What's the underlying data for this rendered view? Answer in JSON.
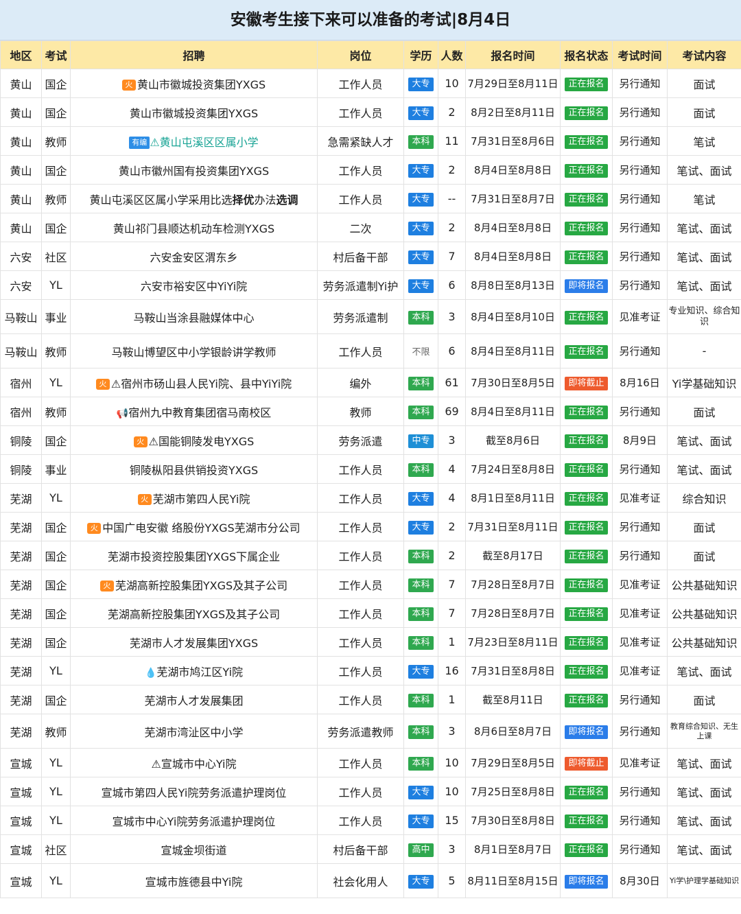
{
  "title": "安徽考生接下来可以准备的考试|8月4日",
  "headers": [
    "地区",
    "考试",
    "招聘",
    "岗位",
    "学历",
    "人数",
    "报名时间",
    "报名状态",
    "考试时间",
    "考试内容"
  ],
  "rows": [
    {
      "region": "黄山",
      "type": "国企",
      "prefix": "火",
      "recruit": "黄山市徽城投资集团YXGS",
      "post": "工作人员",
      "edu": "大专",
      "count": "10",
      "time": "7月29日至8月11日",
      "status": "正在报名",
      "exam_time": "另行通知",
      "content": "面试"
    },
    {
      "region": "黄山",
      "type": "国企",
      "recruit": "黄山市徽城投资集团YXGS",
      "post": "工作人员",
      "edu": "大专",
      "count": "2",
      "time": "8月2日至8月11日",
      "status": "正在报名",
      "exam_time": "另行通知",
      "content": "面试"
    },
    {
      "region": "黄山",
      "type": "教师",
      "tag": "有编",
      "recruit": "⚠黄山屯溪区区属小学",
      "post": "急需紧缺人才",
      "edu": "本科",
      "count": "11",
      "time": "7月31日至8月6日",
      "status": "正在报名",
      "exam_time": "另行通知",
      "content": "笔试"
    },
    {
      "region": "黄山",
      "type": "国企",
      "recruit": "黄山市徽州国有投资集团YXGS",
      "post": "工作人员",
      "edu": "大专",
      "count": "2",
      "time": "8月4日至8月8日",
      "status": "正在报名",
      "exam_time": "另行通知",
      "content": "笔试、面试"
    },
    {
      "region": "黄山",
      "type": "教师",
      "recruit": "黄山屯溪区区属小学采用比选",
      "recruit_bold": "择优",
      "recruit_tail": "办法",
      "recruit_bold2": "选调",
      "post": "工作人员",
      "edu": "大专",
      "count": "--",
      "time": "7月31日至8月7日",
      "status": "正在报名",
      "exam_time": "另行通知",
      "content": "笔试"
    },
    {
      "region": "黄山",
      "type": "国企",
      "recruit": "黄山祁门县顺达机动车检测YXGS",
      "post": "二次",
      "edu": "大专",
      "count": "2",
      "time": "8月4日至8月8日",
      "status": "正在报名",
      "exam_time": "另行通知",
      "content": "笔试、面试"
    },
    {
      "region": "六安",
      "type": "社区",
      "recruit": "六安金安区渭东乡",
      "post": "村后备干部",
      "edu": "大专",
      "count": "7",
      "time": "8月4日至8月8日",
      "status": "正在报名",
      "exam_time": "另行通知",
      "content": "笔试、面试"
    },
    {
      "region": "六安",
      "type": "YL",
      "recruit": "六安市裕安区中YiYi院",
      "post": "劳务派遣制Yi护",
      "post_bold": "派遣制",
      "edu": "大专",
      "count": "6",
      "time": "8月8日至8月13日",
      "status": "即将报名",
      "exam_time": "另行通知",
      "content": "笔试、面试"
    },
    {
      "region": "马鞍山",
      "type": "事业",
      "recruit": "马鞍山当涂县融媒体中心",
      "post": "劳务派遣制",
      "post_bold": "派遣制",
      "edu": "本科",
      "count": "3",
      "time": "8月4日至8月10日",
      "status": "正在报名",
      "exam_time": "见准考证",
      "content": "专业知识、综合知识"
    },
    {
      "region": "马鞍山",
      "type": "教师",
      "recruit": "马鞍山博望区中小学银龄讲学教师",
      "post": "工作人员",
      "edu": "不限",
      "count": "6",
      "time": "8月4日至8月11日",
      "status": "正在报名",
      "exam_time": "另行通知",
      "content": "-"
    },
    {
      "region": "宿州",
      "type": "YL",
      "prefix": "火",
      "recruit": "⚠宿州市砀山县人民Yi院、县中YiYi院",
      "post": "编外",
      "edu": "本科",
      "count": "61",
      "time": "7月30日至8月5日",
      "status": "即将截止",
      "exam_time": "8月16日",
      "content": "Yi学基础知识"
    },
    {
      "region": "宿州",
      "type": "教师",
      "prefix": "📢",
      "recruit": "宿州九中教育集团宿马南校区",
      "post": "教师",
      "edu": "本科",
      "count": "69",
      "time": "8月4日至8月11日",
      "status": "正在报名",
      "exam_time": "另行通知",
      "content": "面试"
    },
    {
      "region": "铜陵",
      "type": "国企",
      "prefix": "火",
      "recruit": "⚠国能铜陵发电YXGS",
      "post": "劳务派遣",
      "edu": "中专",
      "count": "3",
      "time": "截至8月6日",
      "status": "正在报名",
      "exam_time": "8月9日",
      "content": "笔试、面试"
    },
    {
      "region": "铜陵",
      "type": "事业",
      "recruit": "铜陵枞阳县供销投资YXGS",
      "post": "工作人员",
      "edu": "本科",
      "count": "4",
      "time": "7月24日至8月8日",
      "status": "正在报名",
      "exam_time": "另行通知",
      "content": "笔试、面试"
    },
    {
      "region": "芜湖",
      "type": "YL",
      "prefix": "火",
      "recruit": "芜湖市第四人民Yi院",
      "post": "工作人员",
      "edu": "大专",
      "count": "4",
      "time": "8月1日至8月11日",
      "status": "正在报名",
      "exam_time": "见准考证",
      "content": "综合知识"
    },
    {
      "region": "芜湖",
      "type": "国企",
      "prefix": "火",
      "recruit": "中国广电安徽 络股份YXGS芜湖市分公司",
      "post": "工作人员",
      "edu": "大专",
      "count": "2",
      "time": "7月31日至8月11日",
      "status": "正在报名",
      "exam_time": "另行通知",
      "content": "面试"
    },
    {
      "region": "芜湖",
      "type": "国企",
      "recruit": "芜湖市投资控股集团YXGS下属企业",
      "post": "工作人员",
      "edu": "本科",
      "count": "2",
      "time": "截至8月17日",
      "status": "正在报名",
      "exam_time": "另行通知",
      "content": "面试"
    },
    {
      "region": "芜湖",
      "type": "国企",
      "prefix": "火",
      "recruit": "芜湖高新控股集团YXGS及其子公司",
      "post": "工作人员",
      "edu": "本科",
      "count": "7",
      "time": "7月28日至8月7日",
      "status": "正在报名",
      "exam_time": "见准考证",
      "content": "公共基础知识"
    },
    {
      "region": "芜湖",
      "type": "国企",
      "recruit": "芜湖高新控股集团YXGS及其子公司",
      "post": "工作人员",
      "edu": "本科",
      "count": "7",
      "time": "7月28日至8月7日",
      "status": "正在报名",
      "exam_time": "见准考证",
      "content": "公共基础知识"
    },
    {
      "region": "芜湖",
      "type": "国企",
      "recruit": "芜湖市人才发展集团YXGS",
      "post": "工作人员",
      "edu": "本科",
      "count": "1",
      "time": "7月23日至8月11日",
      "status": "正在报名",
      "exam_time": "见准考证",
      "content": "公共基础知识"
    },
    {
      "region": "芜湖",
      "type": "YL",
      "prefix": "💧",
      "recruit": "芜湖市鸠江区Yi院",
      "post": "工作人员",
      "edu": "大专",
      "count": "16",
      "time": "7月31日至8月8日",
      "status": "正在报名",
      "exam_time": "见准考证",
      "content": "笔试、面试"
    },
    {
      "region": "芜湖",
      "type": "国企",
      "recruit": "芜湖市人才发展集团",
      "post": "工作人员",
      "edu": "本科",
      "count": "1",
      "time": "截至8月11日",
      "status": "正在报名",
      "exam_time": "另行通知",
      "content": "面试"
    },
    {
      "region": "芜湖",
      "type": "教师",
      "recruit": "芜湖市湾沚区中小学",
      "post": "劳务派遣教师",
      "edu": "本科",
      "count": "3",
      "time": "8月6日至8月7日",
      "status": "即将报名",
      "exam_time": "另行通知",
      "content": "教育综合知识、无生上课"
    },
    {
      "region": "宣城",
      "type": "YL",
      "recruit": "⚠宣城市中心Yi院",
      "post": "工作人员",
      "edu": "本科",
      "count": "10",
      "time": "7月29日至8月5日",
      "status": "即将截止",
      "exam_time": "见准考证",
      "content": "笔试、面试"
    },
    {
      "region": "宣城",
      "type": "YL",
      "recruit": "宣城市第四人民Yi院劳务派遣护理岗位",
      "post": "工作人员",
      "edu": "大专",
      "count": "10",
      "time": "7月25日至8月8日",
      "status": "正在报名",
      "exam_time": "另行通知",
      "content": "笔试、面试"
    },
    {
      "region": "宣城",
      "type": "YL",
      "recruit": "宣城市中心Yi院劳务派遣护理岗位",
      "post": "工作人员",
      "edu": "大专",
      "count": "15",
      "time": "7月30日至8月8日",
      "status": "正在报名",
      "exam_time": "另行通知",
      "content": "笔试、面试"
    },
    {
      "region": "宣城",
      "type": "社区",
      "recruit": "宣城金坝街道",
      "post": "村后备干部",
      "edu": "高中",
      "count": "3",
      "time": "8月1日至8月7日",
      "status": "正在报名",
      "exam_time": "另行通知",
      "content": "笔试、面试"
    },
    {
      "region": "宣城",
      "type": "YL",
      "recruit": "宣城市旌德县中Yi院",
      "post": "社会化用人",
      "edu": "大专",
      "count": "5",
      "time": "8月11日至8月15日",
      "status": "即将报名",
      "exam_time": "8月30日",
      "content": "Yi学\\护理学基础知识"
    }
  ],
  "colors": {
    "title_bg": "#dcebf7",
    "header_bg": "#fde9a6",
    "edu_dazhuan": "#1e7fe0",
    "edu_benke": "#2fa84f",
    "status_zhengzai": "#27a843",
    "status_jijiang": "#2b7de9",
    "status_jiezhi": "#ee5b2e"
  }
}
